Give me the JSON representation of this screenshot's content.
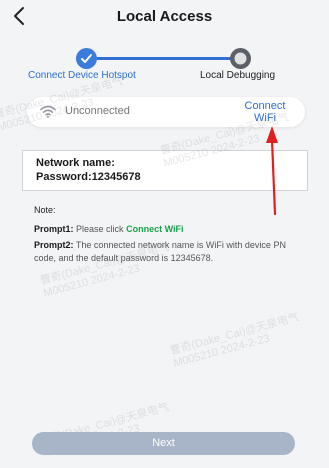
{
  "header": {
    "title": "Local Access"
  },
  "stepper": {
    "steps": [
      {
        "label": "Connect Device Hotspot",
        "state": "done"
      },
      {
        "label": "Local Debugging",
        "state": "pending"
      }
    ]
  },
  "wifi": {
    "status": "Unconnected",
    "connect_line1": "Connect",
    "connect_line2": "WiFi"
  },
  "network": {
    "name_label": "Network name:",
    "password_label": "Password:",
    "password_value": "12345678"
  },
  "notes": {
    "title": "Note:",
    "prompt1_label": "Prompt1:",
    "prompt1_text": "Please click",
    "prompt1_link": "Connect WiFi",
    "prompt2_label": "Prompt2:",
    "prompt2_text": "The connected network name is WiFi with device PN code, and the default password is 12345678."
  },
  "watermark": {
    "line1": "曹奇(Dake_Cai)@天泉电气",
    "line2": "M005210 2024-2-23"
  },
  "next_label": "Next",
  "colors": {
    "accent": "#2e6fcf",
    "step_done": "#3a7bdc",
    "step_pending": "#5b5f66",
    "link_green": "#17a34a",
    "arrow_red": "#e02020",
    "next_disabled": "#a8b4c8"
  },
  "icons": {
    "back": "back-arrow-icon",
    "step_done": "check-icon",
    "wifi": "wifi-icon"
  }
}
